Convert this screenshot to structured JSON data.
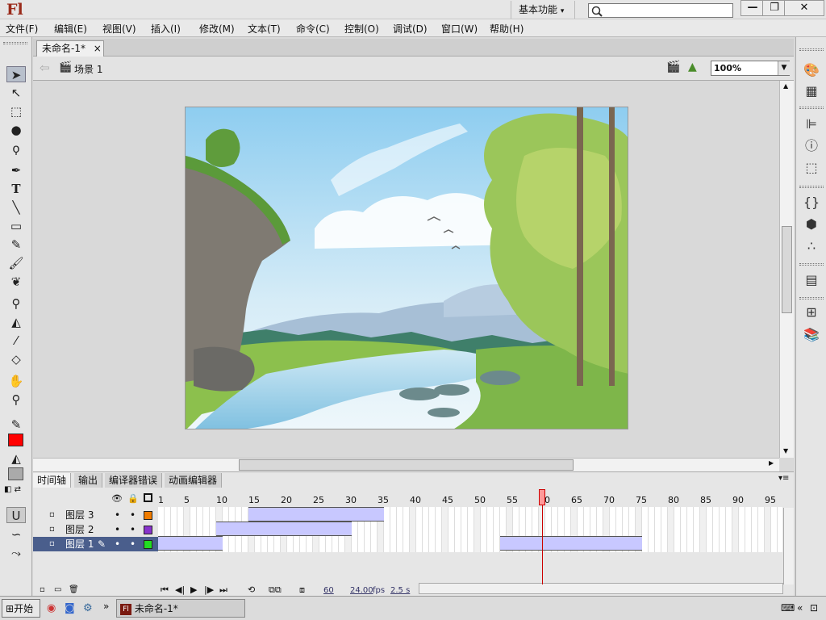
{
  "app": {
    "logo": "Fl",
    "workspace": "基本功能"
  },
  "window_buttons": {
    "minimize": "—",
    "restore": "❐",
    "close": "✕"
  },
  "menu": [
    "文件(F)",
    "编辑(E)",
    "视图(V)",
    "插入(I)",
    "修改(M)",
    "文本(T)",
    "命令(C)",
    "控制(O)",
    "调试(D)",
    "窗口(W)",
    "帮助(H)"
  ],
  "document": {
    "tab_label": "未命名-1*",
    "close_glyph": "×",
    "scene": "场景 1",
    "zoom": "100%"
  },
  "tools": [
    "selection-arrow",
    "subselection-arrow",
    "free-transform",
    "3d-rotation",
    "lasso",
    "pen",
    "text",
    "line",
    "rectangle",
    "pencil",
    "brush",
    "deco",
    "bone",
    "paint-bucket",
    "eyedropper",
    "eraser",
    "hand",
    "zoom"
  ],
  "colors": {
    "stroke": "#222222",
    "fill": "#ff0000",
    "accent_playhead": "#cc0000",
    "tween": "#c8c8ff",
    "selected_layer": "#4a5e8c"
  },
  "panel_tabs": [
    "时间轴",
    "输出",
    "编译器错误",
    "动画编辑器"
  ],
  "timeline": {
    "ruler": [
      "1",
      "5",
      "10",
      "15",
      "20",
      "25",
      "30",
      "35",
      "40",
      "45",
      "50",
      "55",
      "60",
      "65",
      "70",
      "75",
      "80",
      "85",
      "90",
      "95"
    ],
    "playhead_frame": 60,
    "layers": [
      {
        "name": "图层 3",
        "swatch": "#f07c00",
        "selected": false
      },
      {
        "name": "图层 2",
        "swatch": "#8833cc",
        "selected": false
      },
      {
        "name": "图层 1",
        "swatch": "#22dd22",
        "selected": true
      }
    ],
    "footer": {
      "current_frame": "60",
      "fps": "24.00",
      "fps_unit": "fps",
      "time": "2.5 s"
    }
  },
  "taskbar": {
    "start": "开始",
    "task": "未命名-1*",
    "more": "»"
  }
}
